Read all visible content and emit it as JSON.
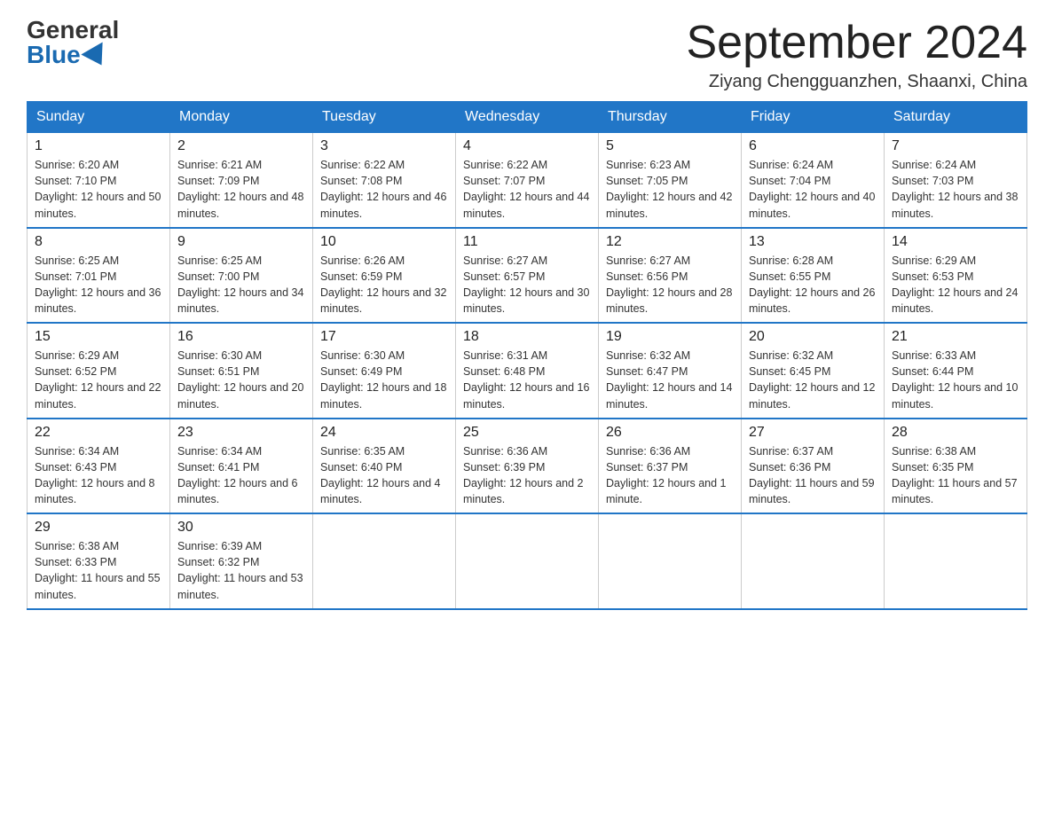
{
  "header": {
    "logo_general": "General",
    "logo_blue": "Blue",
    "month_title": "September 2024",
    "location": "Ziyang Chengguanzhen, Shaanxi, China"
  },
  "weekdays": [
    "Sunday",
    "Monday",
    "Tuesday",
    "Wednesday",
    "Thursday",
    "Friday",
    "Saturday"
  ],
  "weeks": [
    [
      {
        "day": "1",
        "sunrise": "6:20 AM",
        "sunset": "7:10 PM",
        "daylight": "12 hours and 50 minutes."
      },
      {
        "day": "2",
        "sunrise": "6:21 AM",
        "sunset": "7:09 PM",
        "daylight": "12 hours and 48 minutes."
      },
      {
        "day": "3",
        "sunrise": "6:22 AM",
        "sunset": "7:08 PM",
        "daylight": "12 hours and 46 minutes."
      },
      {
        "day": "4",
        "sunrise": "6:22 AM",
        "sunset": "7:07 PM",
        "daylight": "12 hours and 44 minutes."
      },
      {
        "day": "5",
        "sunrise": "6:23 AM",
        "sunset": "7:05 PM",
        "daylight": "12 hours and 42 minutes."
      },
      {
        "day": "6",
        "sunrise": "6:24 AM",
        "sunset": "7:04 PM",
        "daylight": "12 hours and 40 minutes."
      },
      {
        "day": "7",
        "sunrise": "6:24 AM",
        "sunset": "7:03 PM",
        "daylight": "12 hours and 38 minutes."
      }
    ],
    [
      {
        "day": "8",
        "sunrise": "6:25 AM",
        "sunset": "7:01 PM",
        "daylight": "12 hours and 36 minutes."
      },
      {
        "day": "9",
        "sunrise": "6:25 AM",
        "sunset": "7:00 PM",
        "daylight": "12 hours and 34 minutes."
      },
      {
        "day": "10",
        "sunrise": "6:26 AM",
        "sunset": "6:59 PM",
        "daylight": "12 hours and 32 minutes."
      },
      {
        "day": "11",
        "sunrise": "6:27 AM",
        "sunset": "6:57 PM",
        "daylight": "12 hours and 30 minutes."
      },
      {
        "day": "12",
        "sunrise": "6:27 AM",
        "sunset": "6:56 PM",
        "daylight": "12 hours and 28 minutes."
      },
      {
        "day": "13",
        "sunrise": "6:28 AM",
        "sunset": "6:55 PM",
        "daylight": "12 hours and 26 minutes."
      },
      {
        "day": "14",
        "sunrise": "6:29 AM",
        "sunset": "6:53 PM",
        "daylight": "12 hours and 24 minutes."
      }
    ],
    [
      {
        "day": "15",
        "sunrise": "6:29 AM",
        "sunset": "6:52 PM",
        "daylight": "12 hours and 22 minutes."
      },
      {
        "day": "16",
        "sunrise": "6:30 AM",
        "sunset": "6:51 PM",
        "daylight": "12 hours and 20 minutes."
      },
      {
        "day": "17",
        "sunrise": "6:30 AM",
        "sunset": "6:49 PM",
        "daylight": "12 hours and 18 minutes."
      },
      {
        "day": "18",
        "sunrise": "6:31 AM",
        "sunset": "6:48 PM",
        "daylight": "12 hours and 16 minutes."
      },
      {
        "day": "19",
        "sunrise": "6:32 AM",
        "sunset": "6:47 PM",
        "daylight": "12 hours and 14 minutes."
      },
      {
        "day": "20",
        "sunrise": "6:32 AM",
        "sunset": "6:45 PM",
        "daylight": "12 hours and 12 minutes."
      },
      {
        "day": "21",
        "sunrise": "6:33 AM",
        "sunset": "6:44 PM",
        "daylight": "12 hours and 10 minutes."
      }
    ],
    [
      {
        "day": "22",
        "sunrise": "6:34 AM",
        "sunset": "6:43 PM",
        "daylight": "12 hours and 8 minutes."
      },
      {
        "day": "23",
        "sunrise": "6:34 AM",
        "sunset": "6:41 PM",
        "daylight": "12 hours and 6 minutes."
      },
      {
        "day": "24",
        "sunrise": "6:35 AM",
        "sunset": "6:40 PM",
        "daylight": "12 hours and 4 minutes."
      },
      {
        "day": "25",
        "sunrise": "6:36 AM",
        "sunset": "6:39 PM",
        "daylight": "12 hours and 2 minutes."
      },
      {
        "day": "26",
        "sunrise": "6:36 AM",
        "sunset": "6:37 PM",
        "daylight": "12 hours and 1 minute."
      },
      {
        "day": "27",
        "sunrise": "6:37 AM",
        "sunset": "6:36 PM",
        "daylight": "11 hours and 59 minutes."
      },
      {
        "day": "28",
        "sunrise": "6:38 AM",
        "sunset": "6:35 PM",
        "daylight": "11 hours and 57 minutes."
      }
    ],
    [
      {
        "day": "29",
        "sunrise": "6:38 AM",
        "sunset": "6:33 PM",
        "daylight": "11 hours and 55 minutes."
      },
      {
        "day": "30",
        "sunrise": "6:39 AM",
        "sunset": "6:32 PM",
        "daylight": "11 hours and 53 minutes."
      },
      null,
      null,
      null,
      null,
      null
    ]
  ]
}
